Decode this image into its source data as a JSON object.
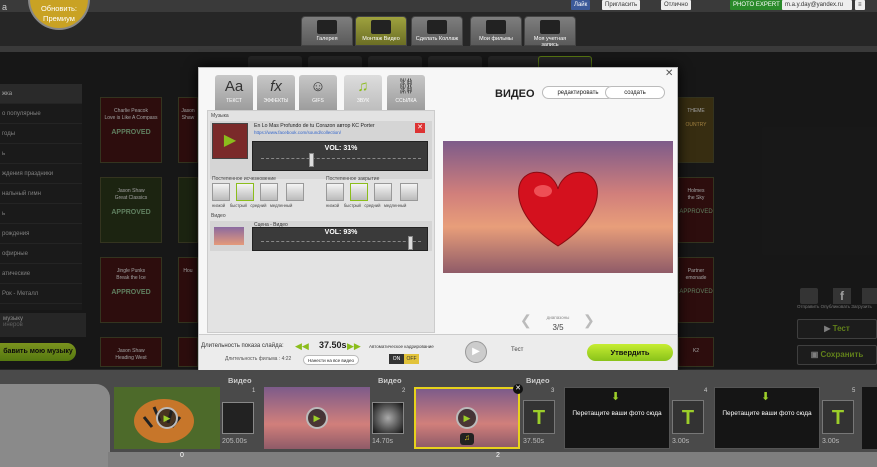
{
  "app": {
    "brand": "a",
    "upgrade_line1": "Обновить:",
    "upgrade_line2": "Премиум"
  },
  "social": {
    "fb": "Лайк",
    "invite": "Пригласить",
    "vk": "Отлично",
    "photo_expert": "PHOTO EXPERT",
    "email": "m.a.y.day@yandex.ru"
  },
  "nav": [
    {
      "label": "Галерея"
    },
    {
      "label": "Монтаж Видео"
    },
    {
      "label": "Сделать Коллаж"
    },
    {
      "label": "Мои фильмы"
    },
    {
      "label": "Моя учетная запись"
    }
  ],
  "left_list": [
    "жка",
    "о популярные",
    "годы",
    "ь",
    "ждения праздники",
    "нальный гимн",
    "ь",
    "рождения",
    "офирные",
    "атические",
    "Рок - Металл",
    "м-Кантри"
  ],
  "left_music": {
    "title": "музыку",
    "sub": "инеров"
  },
  "add_music": "бавить мою музыку",
  "albums": [
    {
      "line1": "Charlie Peacok",
      "line2": "Love is Like A Compass",
      "badge": "APPROVED"
    },
    {
      "line1": "Jason Shaw",
      "line2": "Great Classics",
      "badge": "APPROVED"
    },
    {
      "line1": "Jingle Punks",
      "line2": "Break the Ice",
      "badge": "APPROVED"
    },
    {
      "line1": "Jason Shaw",
      "line2": "Heading West",
      "badge": ""
    },
    {
      "line1": "Jason Shaw",
      "line2": "Just A",
      "badge": ""
    },
    {
      "line1": "Hou",
      "line2": "",
      "badge": ""
    }
  ],
  "right_albums": [
    {
      "line1": "THEME",
      "line2": "",
      "badge": "OUNTRY"
    },
    {
      "line1": "Holmes",
      "line2": "the Sky",
      "badge": "APPROVED"
    },
    {
      "line1": "Partner",
      "line2": "emonade",
      "badge": "APPROVED"
    },
    {
      "line1": "K2",
      "line2": "",
      "badge": ""
    }
  ],
  "right_panel": {
    "icons": [
      "Отправить",
      "Опубликовать",
      "Загрузить"
    ],
    "test": "Тест",
    "save": "Сохранить"
  },
  "modal": {
    "tabs": [
      {
        "label": "ТЕКСТ",
        "glyph": "Aa"
      },
      {
        "label": "ЭФФЕКТЫ",
        "glyph": "fx"
      },
      {
        "label": "GIFS",
        "glyph": "☺"
      },
      {
        "label": "ЗВУК",
        "glyph": "♫"
      },
      {
        "label": "ССЫЛКА",
        "glyph": "⛓"
      }
    ],
    "close": "✕",
    "music_section": "Музыка",
    "track_title": "En Lo Mas Profundo de tu Corazon автор KC Porter",
    "track_link": "https://www.facebook.com/sound/collection/",
    "music_vol": "VOL: 31%",
    "music_vol_level": 0.31,
    "fade_in_label": "Постепенное исчезновение",
    "fade_out_label": "Постепенное закрытие",
    "fade_options": [
      "низкой",
      "быстрый",
      "средний",
      "медленный"
    ],
    "video_section": "Видео",
    "video_name": "Сцена - Видео",
    "video_vol": "VOL: 93%",
    "video_vol_level": 0.93,
    "preview_title": "ВИДЕО",
    "edit_button": "редактировать",
    "create_button": "создать",
    "range_label": "диапазоны",
    "counter": "3/5",
    "duration_label": "Длительность показа слайда:",
    "duration_value": "37.50s",
    "film_duration": "Длительность фильма : 4:22",
    "apply_all": "Нанести на все видео",
    "auto_crop": "Автоматическое кадрирование",
    "on": "ON",
    "off": "OFF",
    "test": "Тест",
    "confirm": "Утвердить"
  },
  "timeline": {
    "slots": [
      {
        "type": "Видео",
        "index": "1",
        "duration": "205.00s"
      },
      {
        "type": "Видео",
        "index": "2",
        "duration": "14.70s"
      },
      {
        "type": "Видео",
        "index": "3",
        "duration": "37.50s",
        "counter": "2"
      },
      {
        "type": "",
        "index": "4",
        "placeholder": "Перетащите ваши фото сюда",
        "duration": "3.00s"
      },
      {
        "type": "",
        "index": "5",
        "placeholder": "Перетащите ваши фото сюда",
        "duration": "3.00s"
      }
    ],
    "t_letter": "T",
    "page_indicator": "0"
  }
}
